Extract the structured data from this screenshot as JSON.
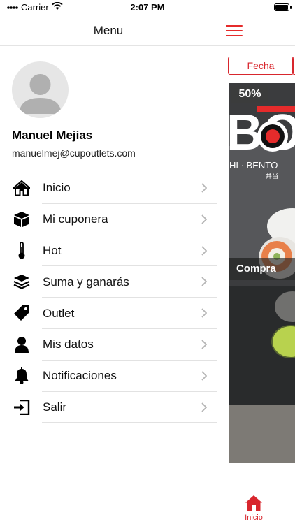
{
  "status_bar": {
    "carrier": "Carrier",
    "time": "2:07 PM"
  },
  "drawer": {
    "title": "Menu",
    "user": {
      "name": "Manuel Mejias",
      "email": "manuelmej@cupoutlets.com"
    },
    "items": [
      {
        "label": "Inicio",
        "icon": "home-icon"
      },
      {
        "label": "Mi cuponera",
        "icon": "box-icon"
      },
      {
        "label": "Hot",
        "icon": "thermometer-icon"
      },
      {
        "label": "Suma y ganarás",
        "icon": "layers-icon"
      },
      {
        "label": "Outlet",
        "icon": "tag-icon"
      },
      {
        "label": "Mis datos",
        "icon": "user-icon"
      },
      {
        "label": "Notificaciones",
        "icon": "bell-icon"
      },
      {
        "label": "Salir",
        "icon": "sign-out-icon"
      }
    ]
  },
  "background_screen": {
    "filter_tab": "Fecha",
    "promo": {
      "discount": "50%",
      "caption": "Compra",
      "logo_text": "HI · BENTŌ",
      "logo_sub": "弁当"
    },
    "tab_bar": {
      "home_label": "Inicio"
    }
  },
  "colors": {
    "accent": "#d8262d",
    "divider": "#e2e2e2"
  }
}
